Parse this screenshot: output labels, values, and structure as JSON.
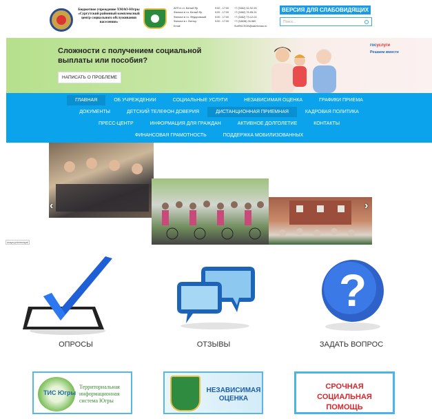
{
  "header": {
    "org_name": "Бюджетное учреждение ХМАО-Югры «Сургутский районный комплексный центр социального обслуживания населения»",
    "contacts": [
      {
        "place": "АУП в г.п. Белый Яр",
        "hours": "9:00 - 17:00",
        "phone": "+7 (3462) 32-92-90"
      },
      {
        "place": "Филиал в г.п. Белый Яр",
        "hours": "9:00 - 17:00",
        "phone": "+7 (3462) 76-55-31"
      },
      {
        "place": "Филиал в г.п. Фёдоровский",
        "hours": "9:00 - 17:00",
        "phone": "+7 (3462) 73-12-02"
      },
      {
        "place": "Филиал в г. Лянтор",
        "hours": "9:00 - 17:00",
        "phone": "+7 (34638) 26-580"
      },
      {
        "place": "Email",
        "hours": "",
        "phone": "SurRKCSON@admhmao.ru"
      }
    ],
    "vision_button": "ВЕРСИЯ ДЛЯ СЛАБОВИДЯЩИХ",
    "search_placeholder": "Поиск..."
  },
  "banner": {
    "text": "Сложности с получением социальной выплаты или пособия?",
    "button": "НАПИСАТЬ О ПРОБЛЕМЕ",
    "gos_blue": "гос",
    "gos_red": "услуги",
    "gos_sub": "Решаем вместе"
  },
  "nav": {
    "row1": [
      "ГЛАВНАЯ",
      "ОБ УЧРЕЖДЕНИИ",
      "СОЦИАЛЬНЫЕ УСЛУГИ",
      "НЕЗАВИСИМАЯ ОЦЕНКА",
      "ГРАФИКИ ПРИЕМА"
    ],
    "row2": [
      "ДОКУМЕНТЫ",
      "ДЕТСКИЙ ТЕЛЕФОН ДОВЕРИЯ",
      "ДИСТАНЦИОННАЯ ПРИЕМНАЯ",
      "КАДРОВАЯ ПОЛИТИКА"
    ],
    "row3": [
      "ПРЕСС-ЦЕНТР",
      "ИНФОРМАЦИЯ ДЛЯ ГРАЖДАН",
      "АКТИВНОЕ ДОЛГОЛЕТИЕ",
      "КОНТАКТЫ"
    ],
    "row4": [
      "ФИНАНСОВАЯ ГРАМОТНОСТЬ",
      "ПОДДЕРЖКА МОБИЛИЗОВАННЫХ"
    ]
  },
  "slider": {
    "alt_text": "maya-priemnaya/",
    "prev_icon": "chevron-left-icon",
    "next_icon": "chevron-right-icon"
  },
  "features": [
    {
      "label": "ОПРОСЫ",
      "icon": "checkmark-icon"
    },
    {
      "label": "ОТЗЫВЫ",
      "icon": "speech-bubbles-icon"
    },
    {
      "label": "ЗАДАТЬ ВОПРОС",
      "icon": "question-icon"
    }
  ],
  "cards": {
    "tis_badge": "ТИС Югры",
    "tis": "Территориальная информационная система Югры",
    "independent": "НЕЗАВИСИМАЯ ОЦЕНКА",
    "urgent": "СРОЧНАЯ СОЦИАЛЬНАЯ ПОМОЩЬ"
  },
  "colors": {
    "nav": "#0aa3ec",
    "accent": "#1a9be6",
    "urgent_red": "#d8262b"
  }
}
